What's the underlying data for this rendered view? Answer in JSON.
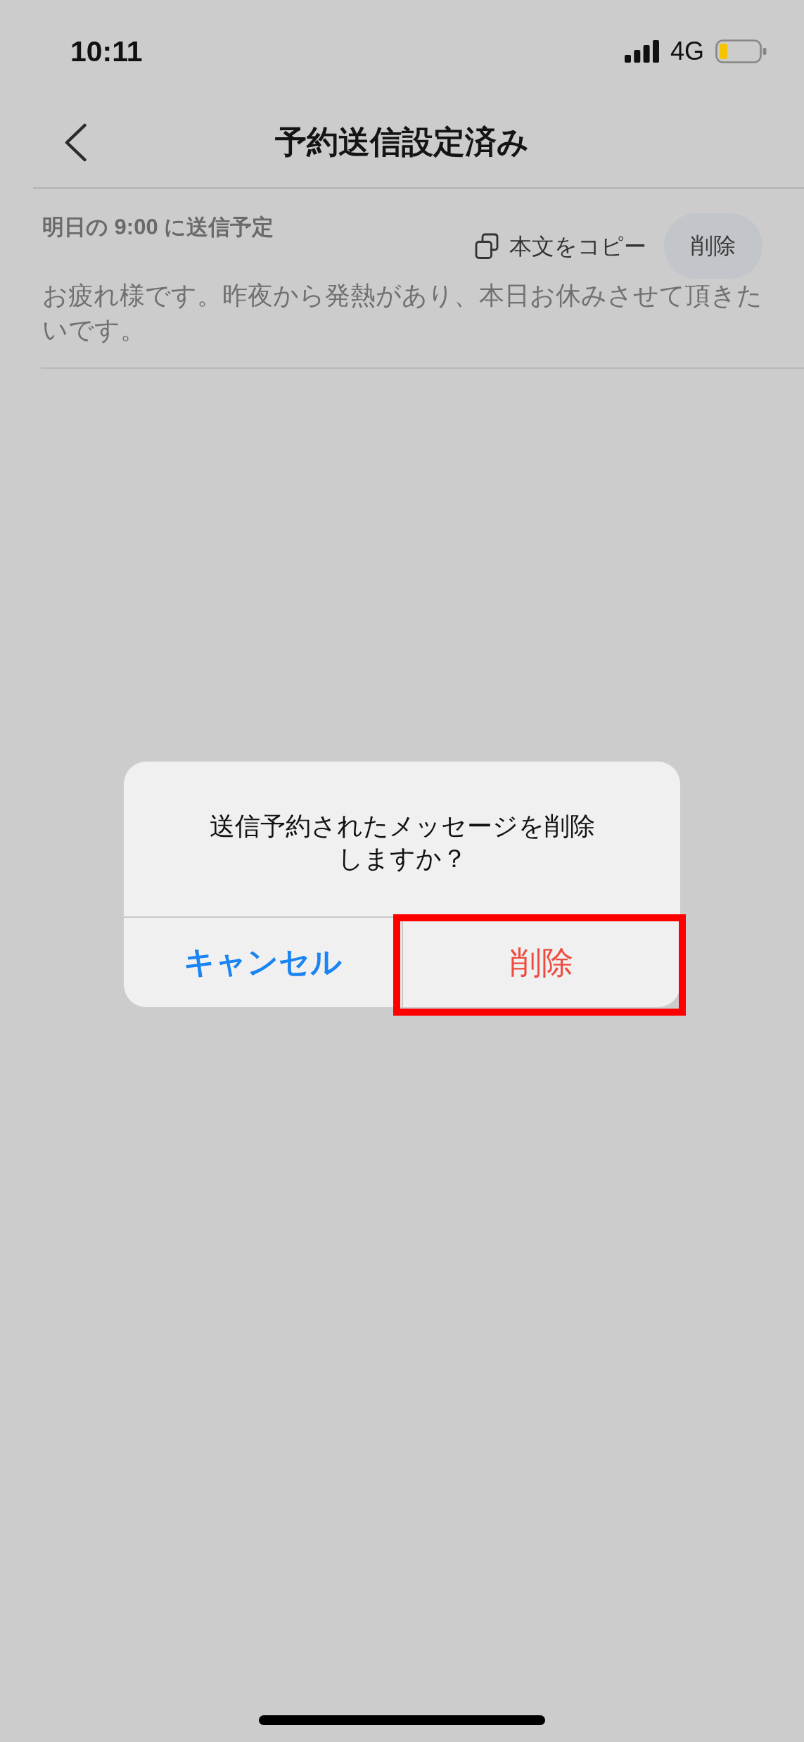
{
  "status_bar": {
    "time": "10:11",
    "network": "4G"
  },
  "nav_bar": {
    "title": "予約送信設定済み"
  },
  "scheduled_messages": [
    {
      "schedule": "明日の 9:00 に送信予定",
      "copy_label": "本文をコピー",
      "delete_label": "削除",
      "body": "お疲れ様です。昨夜から発熱があり、本日お休みさせて頂きたいです。"
    }
  ],
  "dialog": {
    "message": "送信予約されたメッセージを削除しますか？",
    "buttons": [
      {
        "label": "キャンセル",
        "kind": "cancel",
        "highlighted": false
      },
      {
        "label": "削除",
        "kind": "destructive",
        "highlighted": true
      }
    ]
  }
}
